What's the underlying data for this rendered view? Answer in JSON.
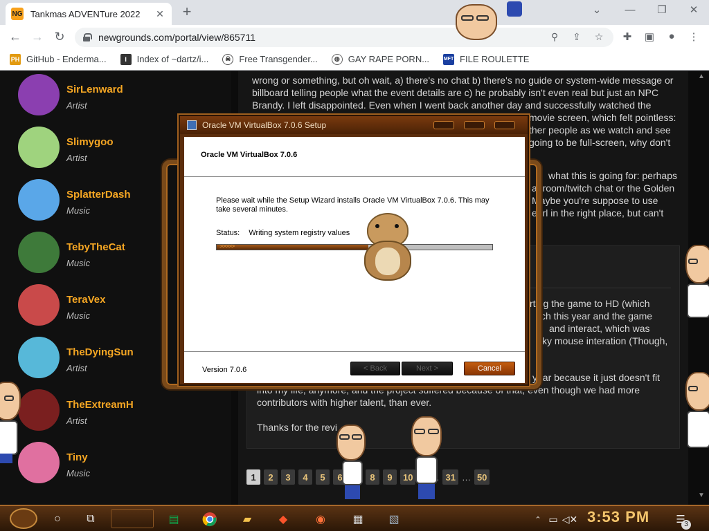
{
  "browser": {
    "tab_title": "Tankmas ADVENTure 2022",
    "tab_favicon_text": "NG",
    "url": "newgrounds.com/portal/view/865711",
    "bookmarks": [
      {
        "label": "GitHub - Enderma...",
        "icon": "PH"
      },
      {
        "label": "Index of ~dartz/i...",
        "icon": "I"
      },
      {
        "label": "Free Transgender...",
        "icon": "skull"
      },
      {
        "label": "GAY RAPE PORN...",
        "icon": "globe"
      },
      {
        "label": "FILE ROULETTE",
        "icon": "MFT"
      }
    ]
  },
  "sidebar": {
    "artists": [
      {
        "name": "SirLenward",
        "role": "Artist",
        "color": "#8b3fb0"
      },
      {
        "name": "Slimygoo",
        "role": "Artist",
        "color": "#9fd37e"
      },
      {
        "name": "SplatterDash",
        "role": "Music",
        "color": "#5aa7e8"
      },
      {
        "name": "TebyTheCat",
        "role": "Music",
        "color": "#3e7a3a"
      },
      {
        "name": "TeraVex",
        "role": "Music",
        "color": "#c94a4a"
      },
      {
        "name": "TheDyingSun",
        "role": "Artist",
        "color": "#57b8d9"
      },
      {
        "name": "TheExtreamH",
        "role": "Artist",
        "color": "#7a1f1f"
      },
      {
        "name": "Tiny",
        "role": "Music",
        "color": "#e070a0"
      }
    ]
  },
  "review": {
    "lines": [
      "wrong or something, but oh wait, a) there's no chat b) there's no guide or system-wide message or",
      "billboard telling people what the event details are c) he probably isn't even real but just an NPC",
      "Brandy. I left disappointed. Even when I went back another day and successfully watched the",
      "movie screen, which felt pointless:",
      "ther people as we watch and see",
      "going to be full-screen, why don't",
      "what this is going for: perhaps",
      "at room/twitch chat or the Golden",
      "Maybe you're suppose to use",
      "earl in the right place, but can't"
    ]
  },
  "comment": {
    "lines_right": [
      "rting the game to HD (which",
      "ch this year and the game",
      "and interact, which was",
      "ky mouse interation (Though,"
    ],
    "line_year": "year because it just doesn't fit",
    "line_life": "into my life, anymore, and the project suffered because of that, even though we had more",
    "line_contrib": "contributors with higher talent, than ever.",
    "line_thanks": "Thanks for the revi"
  },
  "pager": {
    "pages": [
      "1",
      "2",
      "3",
      "4",
      "5",
      "6",
      "8",
      "9",
      "10",
      "31",
      "50"
    ],
    "current": "1",
    "ellipsis": "…"
  },
  "installer": {
    "window_title": "Oracle VM VirtualBox 7.0.6 Setup",
    "heading": "Oracle VM VirtualBox 7.0.6",
    "message": "Please wait while the Setup Wizard installs Oracle VM VirtualBox 7.0.6. This may take several minutes.",
    "status_label": "Status:",
    "status_value": "Writing system registry values",
    "progress": 0.55,
    "progress_chevrons": ">>>>>",
    "version": "Version 7.0.6",
    "back_label": "< Back",
    "next_label": "Next >",
    "cancel_label": "Cancel"
  },
  "taskbar": {
    "clock": "3:53 PM",
    "notification_count": "3"
  },
  "colors": {
    "accent": "#f5a623",
    "steampunk_brown": "#7a4a1a",
    "progress_fill": "#8a4410",
    "cancel_button": "#b24f0b"
  }
}
